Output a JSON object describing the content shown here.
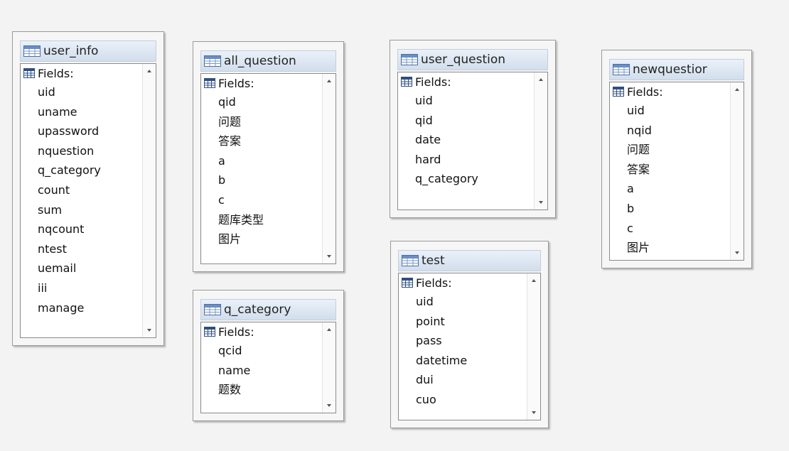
{
  "fields_label": "Fields:",
  "tables": {
    "user_info": {
      "title": "user_info",
      "fields": [
        "uid",
        "uname",
        "upassword",
        "nquestion",
        "q_category",
        "count",
        "sum",
        "nqcount",
        "ntest",
        "uemail",
        "iii",
        "manage"
      ]
    },
    "all_question": {
      "title": "all_question",
      "fields": [
        "qid",
        "问题",
        "答案",
        "a",
        "b",
        "c",
        "题库类型",
        "图片"
      ]
    },
    "q_category": {
      "title": "q_category",
      "fields": [
        "qcid",
        "name",
        "题数"
      ]
    },
    "user_question": {
      "title": "user_question",
      "fields": [
        "uid",
        "qid",
        "date",
        "hard",
        "q_category"
      ]
    },
    "test": {
      "title": "test",
      "fields": [
        "uid",
        "point",
        "pass",
        "datetime",
        "dui",
        "cuo"
      ]
    },
    "newquestion": {
      "title": "newquestior",
      "fields": [
        "uid",
        "nqid",
        "问题",
        "答案",
        "a",
        "b",
        "c",
        "图片"
      ]
    }
  }
}
